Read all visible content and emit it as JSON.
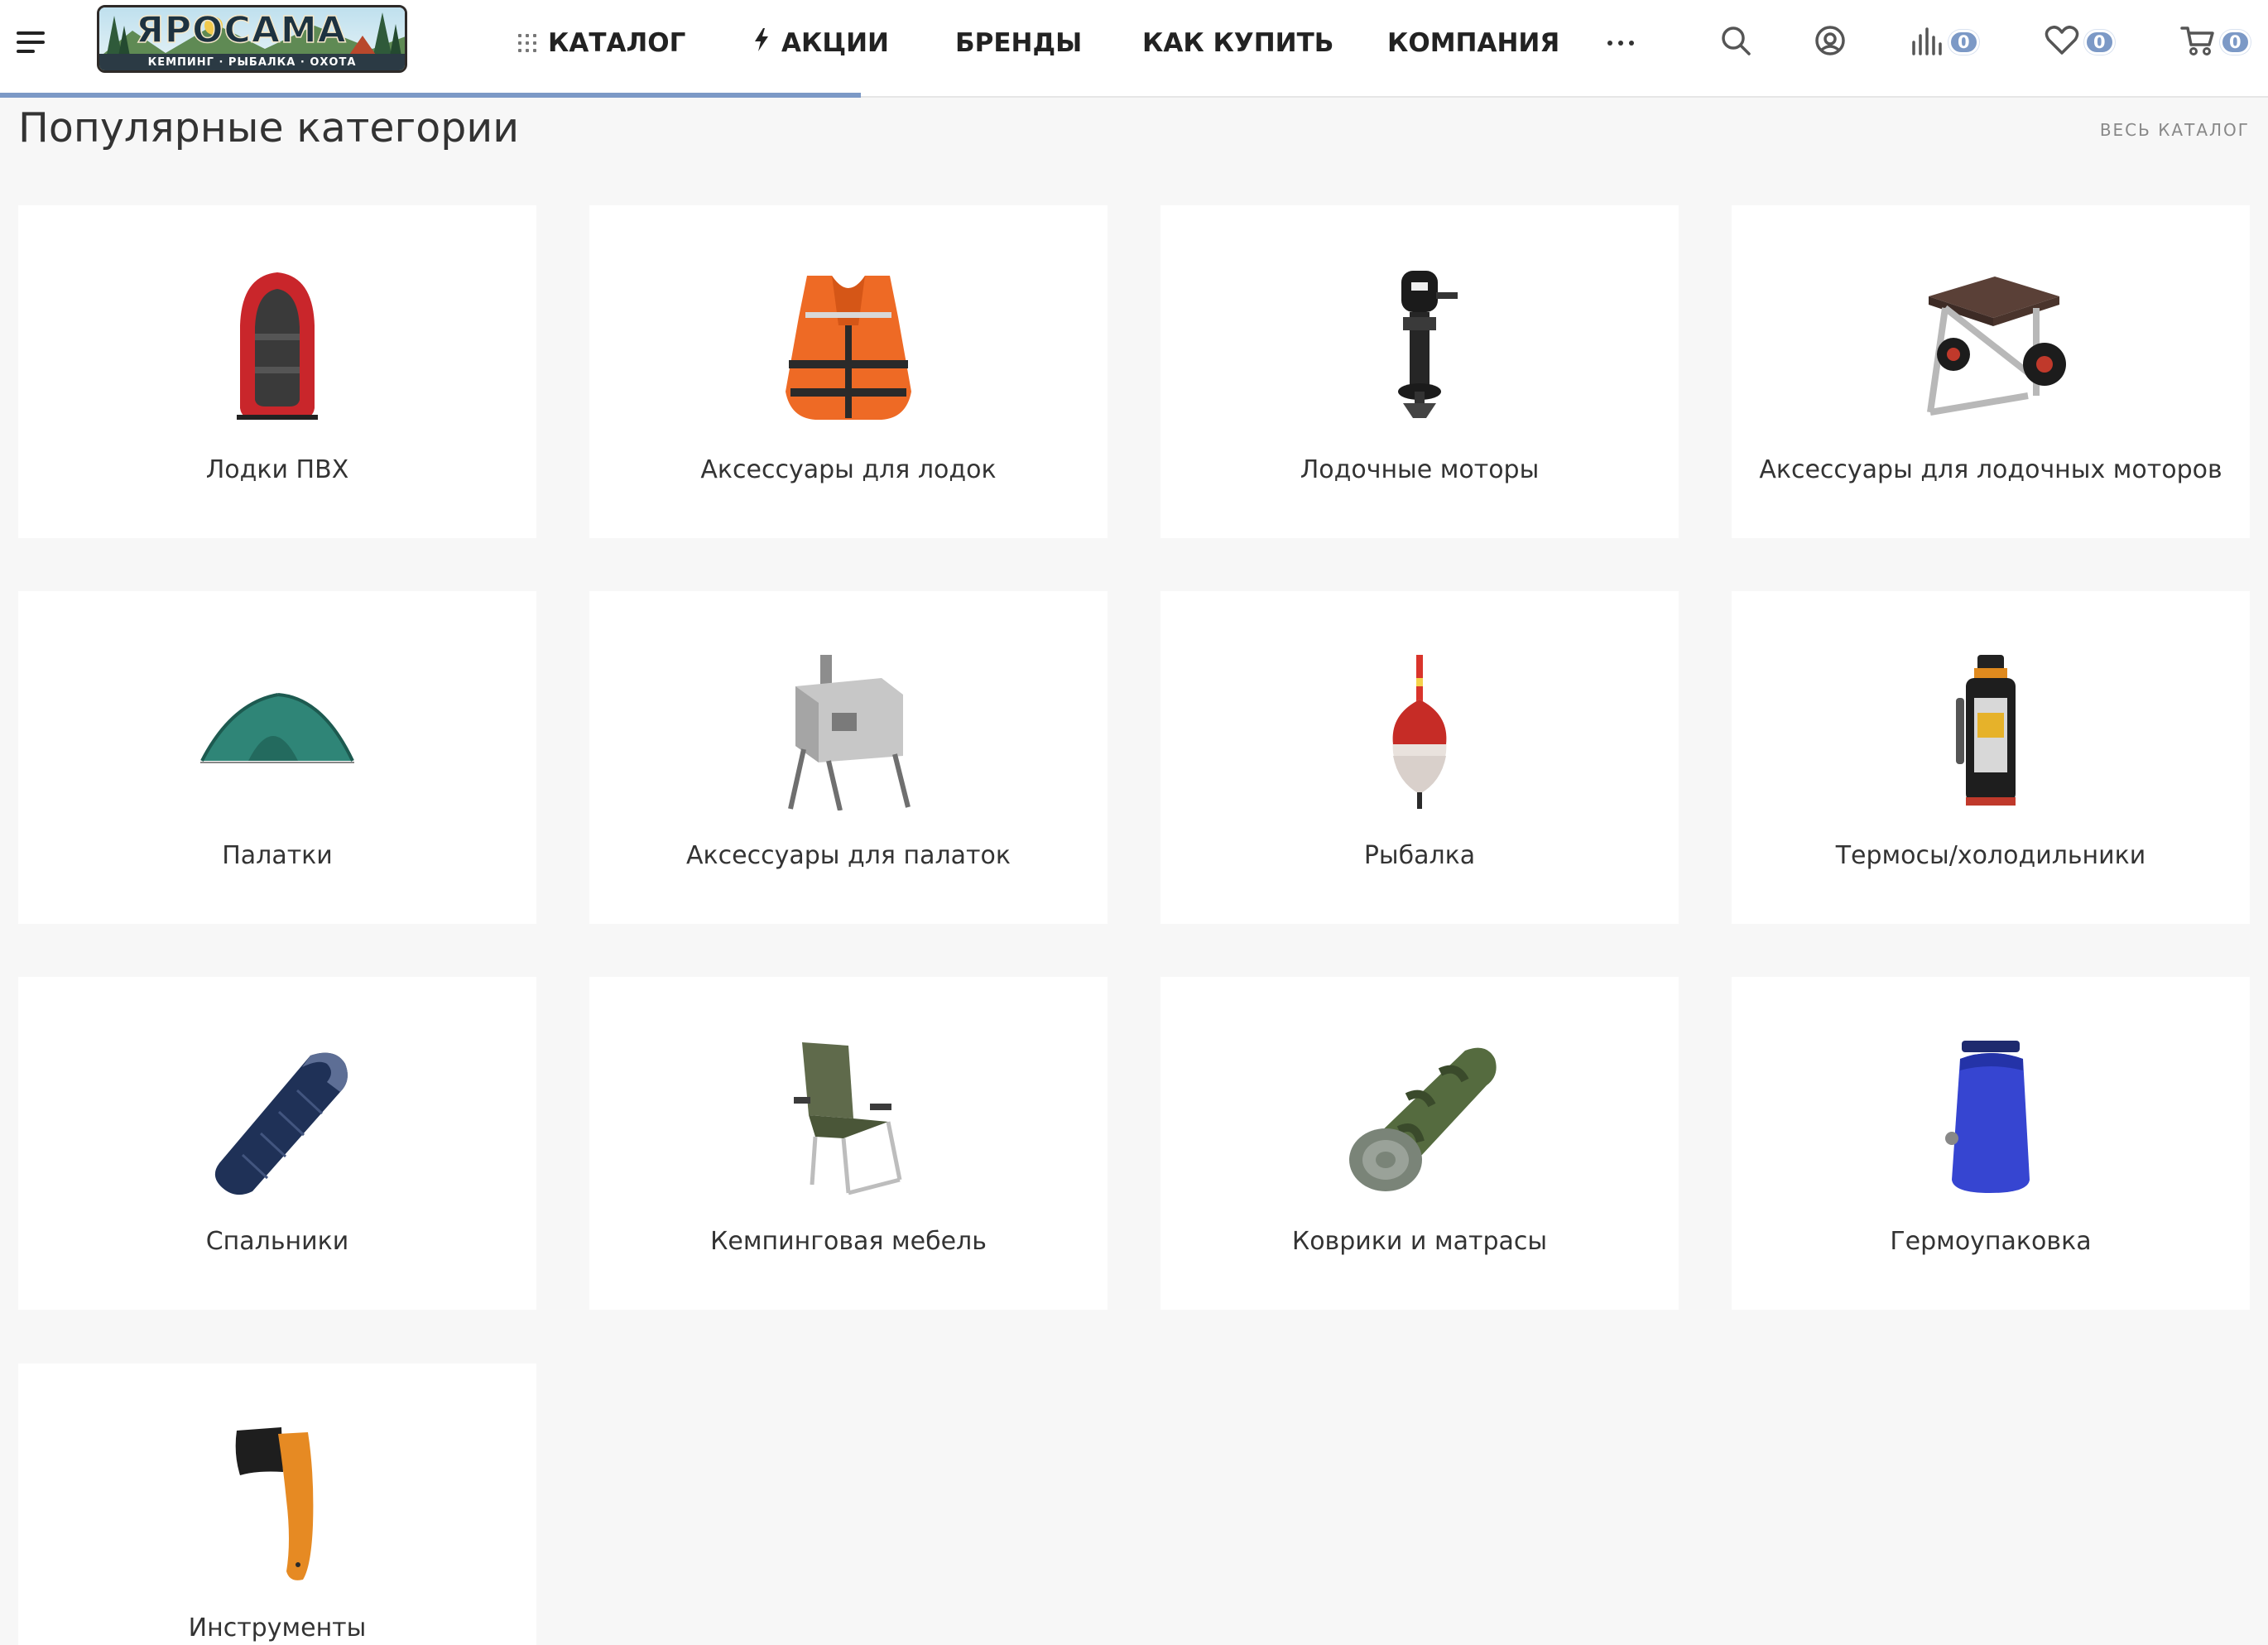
{
  "header": {
    "logo": {
      "text": "ЯРОСАМА",
      "subtitle": "КЕМПИНГ · РЫБАЛКА · ОХОТА"
    },
    "nav": [
      {
        "label": "КАТАЛОГ",
        "icon": "grid-icon"
      },
      {
        "label": "АКЦИИ",
        "icon": "lightning-icon"
      },
      {
        "label": "БРЕНДЫ"
      },
      {
        "label": "КАК КУПИТЬ"
      },
      {
        "label": "КОМПАНИЯ"
      }
    ],
    "compare_count": "0",
    "favorites_count": "0",
    "cart_count": "0",
    "accent_color": "#7c99c6"
  },
  "main": {
    "title": "Популярные категории",
    "all_link": "ВЕСЬ КАТАЛОГ",
    "categories": [
      {
        "label": "Лодки ПВХ",
        "icon": "inflatable-boat-icon"
      },
      {
        "label": "Аксессуары для лодок",
        "icon": "life-vest-icon"
      },
      {
        "label": "Лодочные моторы",
        "icon": "outboard-motor-icon"
      },
      {
        "label": "Аксессуары для лодочных моторов",
        "icon": "motor-trolley-icon"
      },
      {
        "label": "Палатки",
        "icon": "tent-icon"
      },
      {
        "label": "Аксессуары для палаток",
        "icon": "camp-stove-icon"
      },
      {
        "label": "Рыбалка",
        "icon": "fishing-float-icon"
      },
      {
        "label": "Термосы/холодильники",
        "icon": "thermos-icon"
      },
      {
        "label": "Спальники",
        "icon": "sleeping-bag-icon"
      },
      {
        "label": "Кемпинговая мебель",
        "icon": "camping-chair-icon"
      },
      {
        "label": "Коврики и матрасы",
        "icon": "sleeping-mat-icon"
      },
      {
        "label": "Гермоупаковка",
        "icon": "dry-bag-icon"
      },
      {
        "label": "Инструменты",
        "icon": "axe-icon"
      }
    ]
  }
}
